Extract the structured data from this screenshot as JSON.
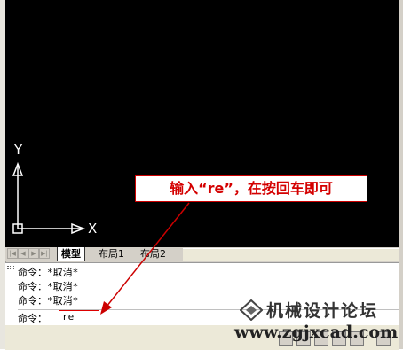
{
  "callout": {
    "text": "输入“re”，在按回车即可"
  },
  "ucs": {
    "x_label": "X",
    "y_label": "Y"
  },
  "tabs": {
    "model": "模型",
    "layout1": "布局1",
    "layout2": "布局2"
  },
  "command_history": [
    "命令：*取消*",
    "命令：*取消*",
    "命令：*取消*"
  ],
  "command_prompt": {
    "label": "命令：",
    "value": "re"
  },
  "watermark": {
    "name": "机械设计论坛",
    "url": "www.zgjxcad.com"
  },
  "colors": {
    "callout_red": "#d40000",
    "drawing_bg": "#000000",
    "arrow_red": "#cc0000"
  }
}
